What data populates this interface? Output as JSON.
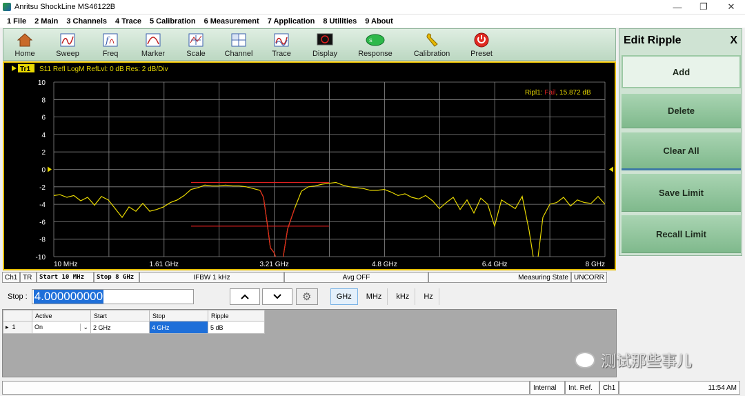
{
  "window": {
    "title": "Anritsu ShockLine MS46122B",
    "min": "—",
    "max": "❐",
    "close": "✕"
  },
  "menu": [
    "1 File",
    "2 Main",
    "3 Channels",
    "4 Trace",
    "5 Calibration",
    "6 Measurement",
    "7 Application",
    "8 Utilities",
    "9 About"
  ],
  "toolbar": [
    {
      "label": "Home",
      "icon": "home-icon"
    },
    {
      "label": "Sweep",
      "icon": "sweep-icon"
    },
    {
      "label": "Freq",
      "icon": "freq-icon"
    },
    {
      "label": "Marker",
      "icon": "marker-icon"
    },
    {
      "label": "Scale",
      "icon": "scale-icon"
    },
    {
      "label": "Channel",
      "icon": "channel-icon"
    },
    {
      "label": "Trace",
      "icon": "trace-icon"
    },
    {
      "label": "Display",
      "icon": "display-icon"
    },
    {
      "label": "Response",
      "icon": "response-icon"
    },
    {
      "label": "Calibration",
      "icon": "calibration-icon"
    },
    {
      "label": "Preset",
      "icon": "preset-icon"
    }
  ],
  "panel": {
    "title": "Edit Ripple",
    "close": "X",
    "buttons": {
      "add": "Add",
      "delete": "Delete",
      "clear": "Clear All",
      "save": "Save Limit",
      "recall": "Recall Limit"
    }
  },
  "chart_header": {
    "trace_tag": "Tr1",
    "info": "S11 Refl LogM RefLvl: 0  dB Res: 2  dB/Div"
  },
  "ripple_status": {
    "label": "Ripl1: ",
    "state": "Fail",
    "value": ", 15.872 dB"
  },
  "chart_data": {
    "type": "line",
    "x_ticks": [
      "10 MHz",
      "1.61 GHz",
      "3.21 GHz",
      "4.8 GHz",
      "6.4 GHz",
      "8 GHz"
    ],
    "y_ticks": [
      "10",
      "8",
      "6",
      "4",
      "2",
      "0",
      "-2",
      "-4",
      "-6",
      "-8",
      "-10"
    ],
    "xlim_ghz": [
      0.01,
      8.0
    ],
    "ylim_db": [
      -10,
      10
    ],
    "ref_level_db": 0,
    "grid": true,
    "colors": {
      "trace": "#e8d800",
      "limit": "#e02020",
      "grid": "#8a8a8a",
      "text": "#ffffff",
      "ref": "#e8d800"
    },
    "series": [
      {
        "x": [
          0.01,
          0.1,
          0.2,
          0.3,
          0.4,
          0.5,
          0.6,
          0.7,
          0.8,
          0.9,
          1.0,
          1.1,
          1.2,
          1.3,
          1.4,
          1.5,
          1.6,
          1.7,
          1.8,
          1.9,
          2.0,
          2.1,
          2.2,
          2.3,
          2.4,
          2.5,
          2.6,
          2.7,
          2.8,
          2.9,
          3.0,
          3.05,
          3.1,
          3.15,
          3.2,
          3.25,
          3.3,
          3.35,
          3.4,
          3.5,
          3.6,
          3.7,
          3.8,
          3.9,
          4.0,
          4.1,
          4.2,
          4.3,
          4.4,
          4.5,
          4.6,
          4.7,
          4.8,
          4.9,
          5.0,
          5.1,
          5.2,
          5.3,
          5.4,
          5.5,
          5.6,
          5.7,
          5.8,
          5.9,
          6.0,
          6.1,
          6.2,
          6.3,
          6.4,
          6.5,
          6.6,
          6.7,
          6.8,
          6.9,
          7.0,
          7.1,
          7.2,
          7.3,
          7.4,
          7.5,
          7.6,
          7.7,
          7.8,
          7.9,
          8.0
        ],
        "y": [
          -3.0,
          -2.9,
          -3.2,
          -3.0,
          -3.6,
          -3.2,
          -4.1,
          -3.1,
          -3.5,
          -4.5,
          -5.5,
          -4.3,
          -4.8,
          -3.9,
          -4.8,
          -4.6,
          -4.3,
          -3.8,
          -3.5,
          -3.0,
          -2.3,
          -2.1,
          -1.8,
          -1.9,
          -1.9,
          -1.8,
          -1.9,
          -1.9,
          -2.0,
          -2.2,
          -2.4,
          -3.2,
          -6.0,
          -9.0,
          -9.5,
          -10.5,
          -12.0,
          -9.3,
          -6.8,
          -4.5,
          -2.5,
          -2.0,
          -1.9,
          -1.7,
          -1.6,
          -1.5,
          -1.8,
          -2.0,
          -2.1,
          -2.2,
          -2.4,
          -2.4,
          -2.3,
          -2.6,
          -3.0,
          -2.8,
          -3.2,
          -3.4,
          -3.0,
          -3.6,
          -4.5,
          -3.8,
          -3.2,
          -4.6,
          -3.5,
          -5.0,
          -3.3,
          -4.0,
          -6.5,
          -3.5,
          -4.0,
          -4.5,
          -3.1,
          -7.0,
          -12.0,
          -5.5,
          -4.0,
          -3.8,
          -3.2,
          -4.2,
          -3.5,
          -3.8,
          -3.9,
          -3.1,
          -4.0
        ]
      }
    ],
    "limits": [
      {
        "x": [
          2.0,
          4.0
        ],
        "y": [
          -1.5,
          -1.5
        ]
      },
      {
        "x": [
          2.0,
          4.0
        ],
        "y": [
          -6.5,
          -6.5
        ]
      }
    ]
  },
  "status": {
    "ch": "Ch1",
    "tr": "TR",
    "start": "Start 10 MHz",
    "stop": "Stop 8 GHz",
    "ifbw": "IFBW 1 kHz",
    "avg": "Avg OFF",
    "state": "Measuring State",
    "cal": "UNCORR"
  },
  "entry": {
    "label": "Stop :",
    "value": "4.000000000",
    "up": "⌃",
    "down": "⌄",
    "units": [
      "GHz",
      "MHz",
      "kHz",
      "Hz"
    ]
  },
  "table": {
    "headers": [
      "",
      "Active",
      "Start",
      "Stop",
      "Ripple"
    ],
    "rows": [
      {
        "marker": "▸",
        "index": "1",
        "active": "On",
        "start": "2 GHz",
        "stop": "4 GHz",
        "ripple": "5 dB"
      }
    ]
  },
  "bottom": {
    "internal": "Internal",
    "ref": "Int. Ref.",
    "ch": "Ch1",
    "time": "11:54 AM"
  },
  "watermark": "测试那些事儿"
}
